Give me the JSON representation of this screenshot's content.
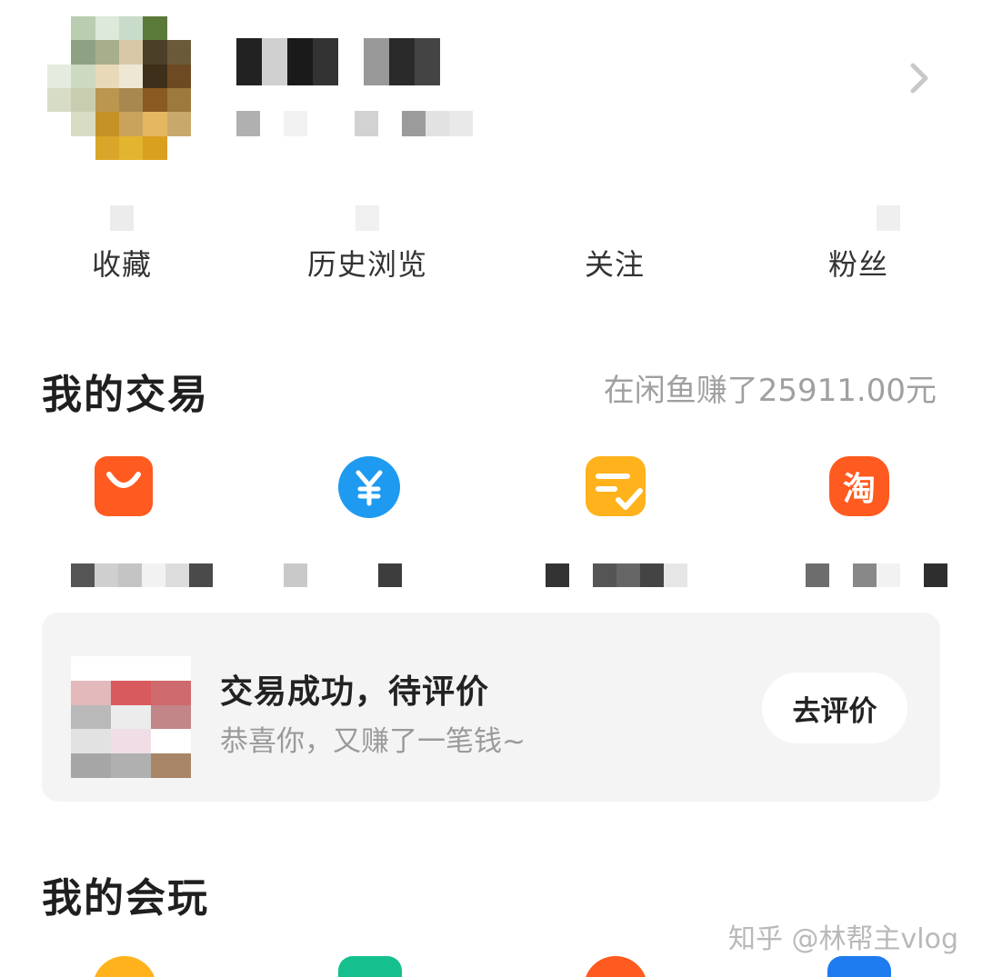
{
  "profile": {
    "avatar_label": "",
    "chevron_icon": "chevron-right-icon"
  },
  "stats": [
    {
      "label": "收藏"
    },
    {
      "label": "历史浏览"
    },
    {
      "label": "关注"
    },
    {
      "label": "粉丝"
    }
  ],
  "trade_section": {
    "title": "我的交易",
    "earned_text": "在闲鱼赚了25911.00元",
    "icons": [
      {
        "name": "shopping-bag-icon",
        "color": "#FF5A1F"
      },
      {
        "name": "yuan-coin-icon",
        "color": "#1E9BF0"
      },
      {
        "name": "note-check-icon",
        "color": "#FFB21C"
      },
      {
        "name": "taobao-icon",
        "color": "#FF5A1F",
        "glyph": "淘"
      }
    ]
  },
  "review_card": {
    "title": "交易成功，待评价",
    "subtitle": "恭喜你，又赚了一笔钱~",
    "button": "去评价"
  },
  "play_section": {
    "title": "我的会玩"
  },
  "watermark": "知乎 @林帮主vlog"
}
